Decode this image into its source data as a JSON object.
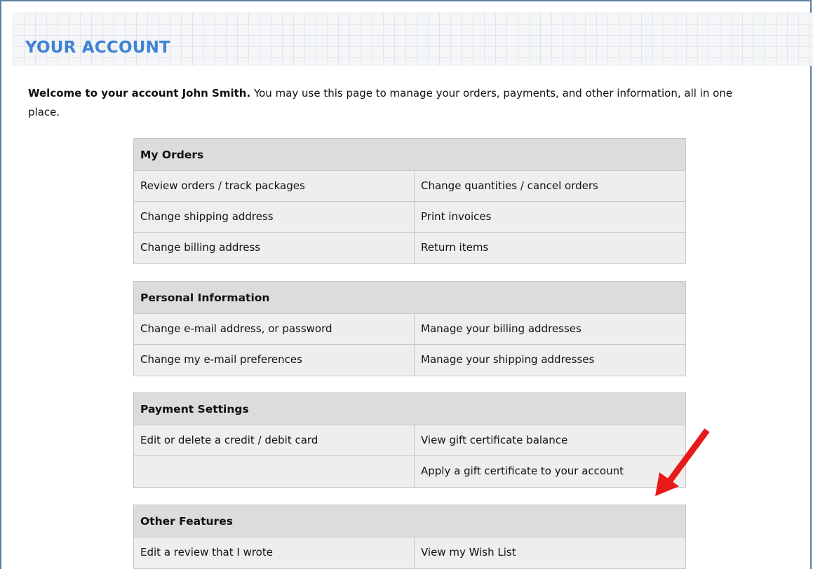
{
  "page": {
    "title": "YOUR ACCOUNT",
    "welcome_bold": "Welcome to your account John Smith.",
    "welcome_text": " You may use this page to manage your orders, payments, and other information, all in one place."
  },
  "sections": [
    {
      "heading": "My Orders",
      "rows": [
        [
          "Review orders / track packages",
          "Change quantities / cancel orders"
        ],
        [
          "Change shipping address",
          "Print invoices"
        ],
        [
          "Change billing address",
          "Return items"
        ]
      ]
    },
    {
      "heading": "Personal Information",
      "rows": [
        [
          "Change e-mail address, or password",
          "Manage your billing addresses"
        ],
        [
          "Change my e-mail preferences",
          "Manage your shipping addresses"
        ]
      ]
    },
    {
      "heading": "Payment Settings",
      "rows": [
        [
          "Edit or delete a credit / debit card",
          "View gift certificate balance"
        ],
        [
          "",
          "Apply a gift certificate to your account"
        ]
      ]
    },
    {
      "heading": "Other Features",
      "rows": [
        [
          "Edit a review that I wrote",
          "View my Wish List"
        ]
      ]
    }
  ],
  "colors": {
    "title": "#3f82d6",
    "annotation_arrow": "#e81919",
    "frame_border": "#5a7fa3"
  },
  "icons": {
    "annotation": "red-arrow-icon"
  }
}
